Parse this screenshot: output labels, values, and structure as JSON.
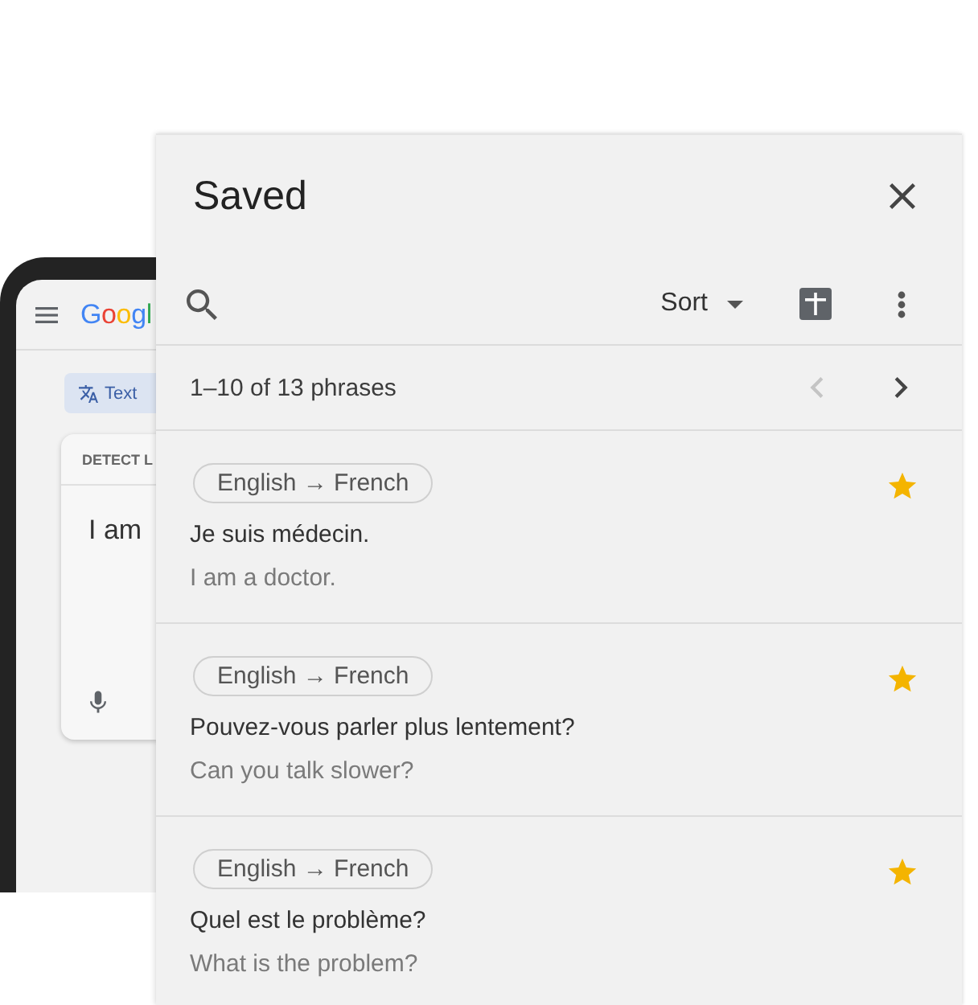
{
  "device": {
    "app_bar": {
      "logo": "Googl"
    },
    "mode_tab": {
      "label": "Text",
      "selected": true
    },
    "input_card": {
      "tab": "DETECT L",
      "text": "I am"
    }
  },
  "panel": {
    "title": "Saved",
    "toolbar": {
      "sort_label": "Sort"
    },
    "pager": {
      "summary": "1–10 of 13 phrases",
      "buttons": [
        {
          "kind": "previous",
          "disabled": true
        },
        {
          "kind": "next",
          "disabled": false
        }
      ]
    },
    "phrases": [
      {
        "language_pair": "English → French",
        "translation": "Je suis médecin.",
        "original": "I am a doctor.",
        "starred": true
      },
      {
        "language_pair": "English → French",
        "translation": "Pouvez-vous parler plus lentement?",
        "original": "Can you talk slower?",
        "starred": true
      },
      {
        "language_pair": "English → French",
        "translation": "Quel est le problème?",
        "original": "What is the problem?",
        "starred": true
      }
    ]
  }
}
